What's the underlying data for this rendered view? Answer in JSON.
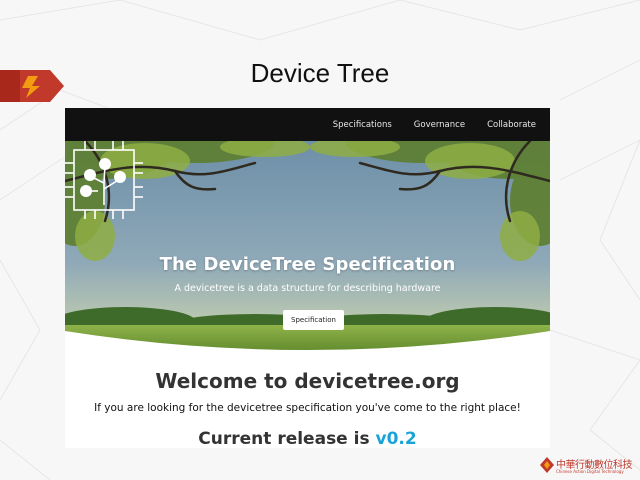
{
  "slide": {
    "title": "Device Tree"
  },
  "nav": {
    "items": [
      {
        "label": "Specifications"
      },
      {
        "label": "Governance"
      },
      {
        "label": "Collaborate"
      }
    ]
  },
  "hero": {
    "title": "The DeviceTree Specification",
    "subtitle": "A devicetree is a data structure for describing hardware",
    "button_label": "Specification",
    "logo_icon": "devicetree-chip-icon"
  },
  "content": {
    "welcome": "Welcome to devicetree.org",
    "intro": "If you are looking for the devicetree specification you've come to the right place!",
    "release_prefix": "Current release is ",
    "release_version": "v0.2"
  },
  "footer": {
    "org_name_cn": "中華行動數位科技",
    "org_name_en": "Chinese Action Digital Technology"
  },
  "colors": {
    "nav_bg": "#111111",
    "accent_version": "#1aa3d9",
    "brand_red": "#c0392b"
  }
}
